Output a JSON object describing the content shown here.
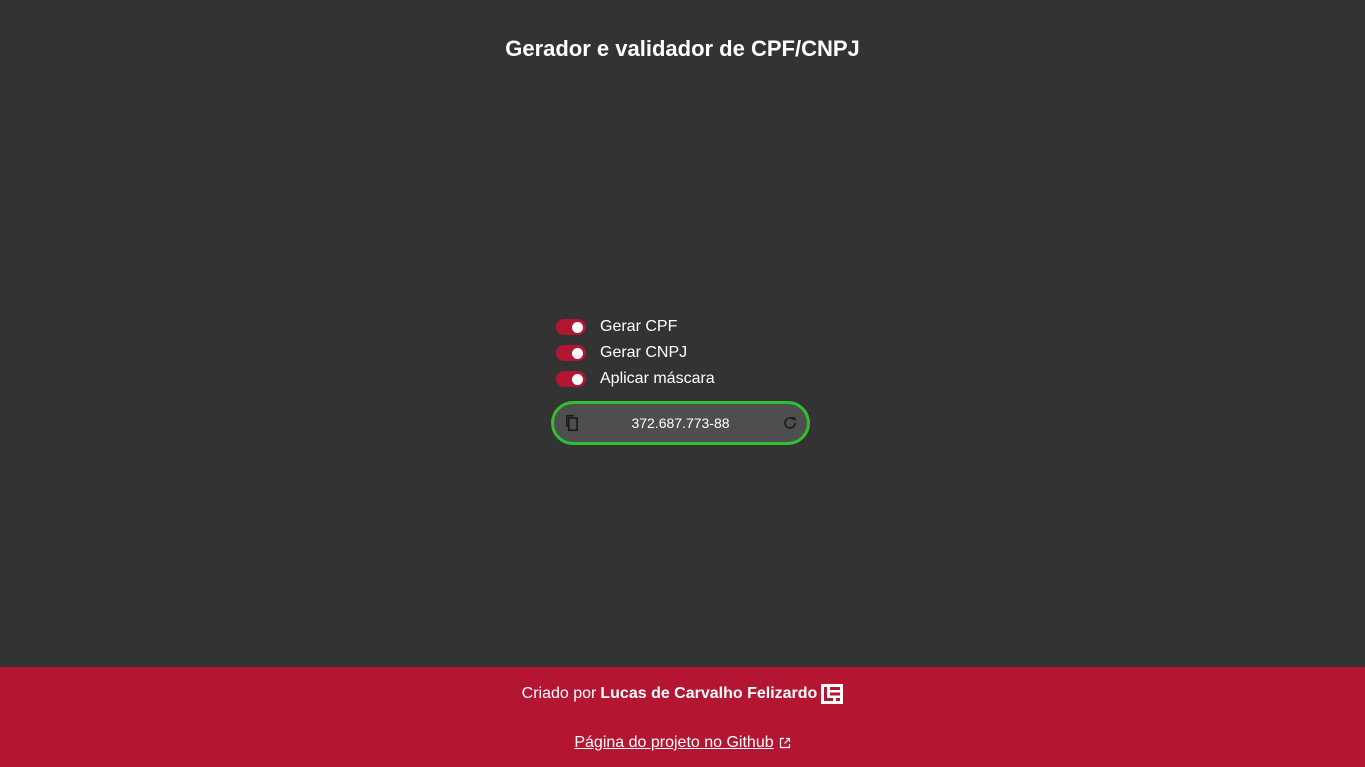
{
  "header": {
    "title": "Gerador e validador de CPF/CNPJ"
  },
  "options": [
    {
      "label": "Gerar CPF",
      "checked": true
    },
    {
      "label": "Gerar CNPJ",
      "checked": true
    },
    {
      "label": "Aplicar máscara",
      "checked": true
    }
  ],
  "result": {
    "value": "372.687.773-88",
    "copy_icon": "copy-icon",
    "refresh_icon": "refresh-icon"
  },
  "footer": {
    "created_by": "Criado por",
    "author": "Lucas de Carvalho Felizardo",
    "logo_icon": "lcf-logo-icon",
    "github_link": "Página do projeto no Github",
    "external_icon": "external-link-icon"
  },
  "colors": {
    "background": "#333333",
    "accent": "#b31532",
    "result_border": "#2fbf2f",
    "result_bg": "#4e4e4e"
  }
}
